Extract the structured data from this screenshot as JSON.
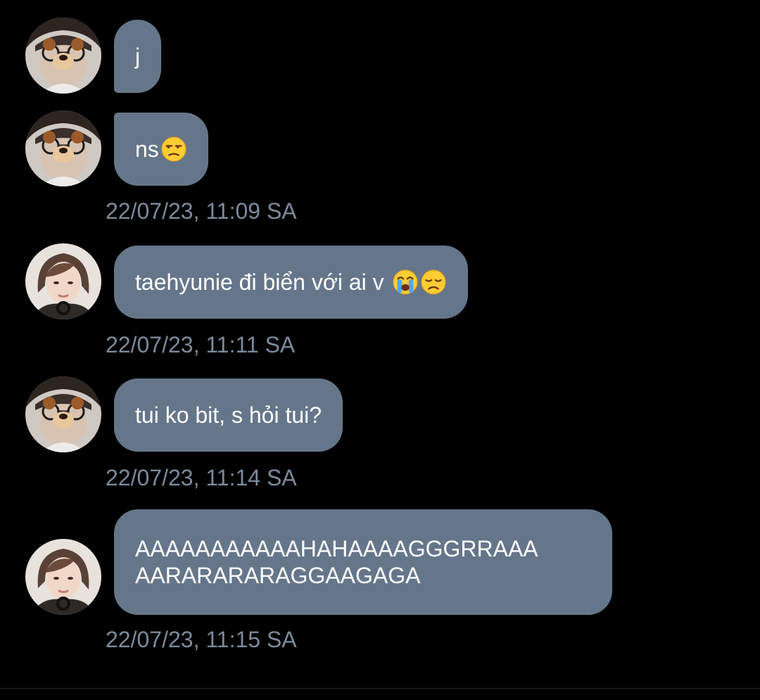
{
  "colors": {
    "background": "#000000",
    "bubble": "#66768a",
    "bubble_text": "#ffffff",
    "timestamp": "#7d8a9c"
  },
  "messages": [
    {
      "sender": "bear-filter-user",
      "text": "j",
      "emoji": []
    },
    {
      "sender": "bear-filter-user",
      "text": "ns",
      "emoji": [
        "unamused-face"
      ],
      "timestamp": "22/07/23, 11:09 SA"
    },
    {
      "sender": "taehyun-user",
      "text": "taehyunie đi biển với ai v ",
      "emoji": [
        "loudly-crying-face",
        "disappointed-face"
      ],
      "timestamp": "22/07/23, 11:11 SA"
    },
    {
      "sender": "bear-filter-user",
      "text": "tui ko bit, s hỏi tui?",
      "emoji": [],
      "timestamp": "22/07/23, 11:14 SA"
    },
    {
      "sender": "taehyun-user",
      "lines": [
        "AAAAAAAAAAAHAHAAAAGGGRRAAA",
        "AARARARARAGGAAGAGA"
      ],
      "emoji": [],
      "timestamp": "22/07/23, 11:15 SA"
    }
  ]
}
